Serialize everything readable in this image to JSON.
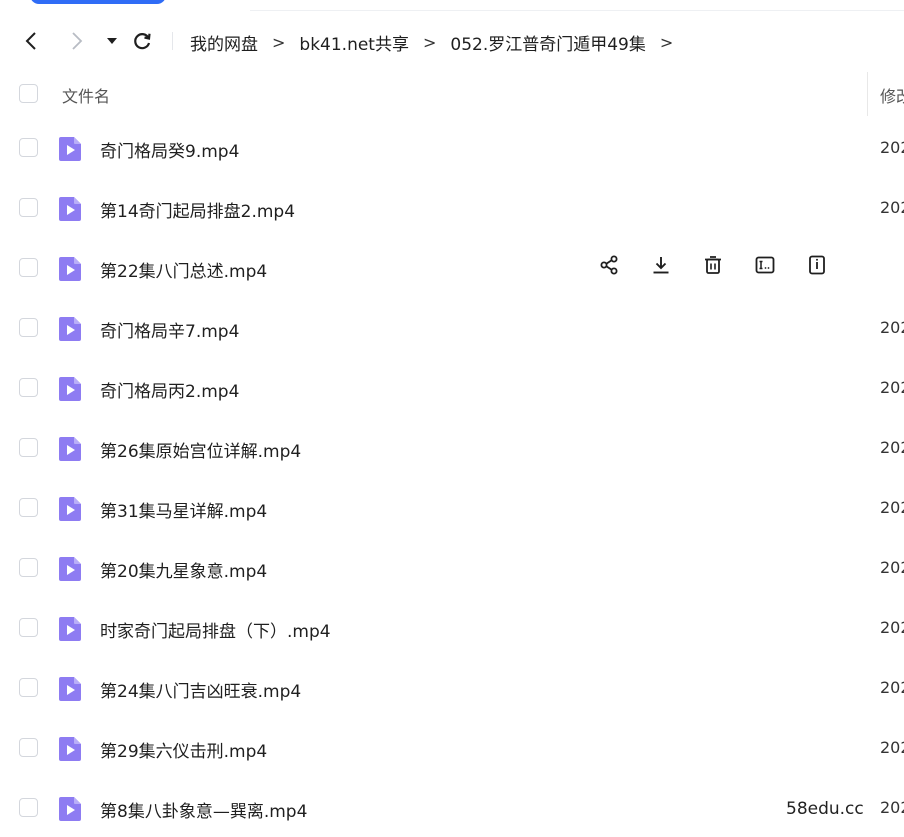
{
  "breadcrumb": [
    "我的网盘",
    "bk41.net共享",
    "052.罗江普奇门遁甲49集"
  ],
  "crumb_separator": ">",
  "header": {
    "name_col": "文件名",
    "modified_col": "修改"
  },
  "files": [
    {
      "name": "奇门格局癸9.mp4",
      "date": "202"
    },
    {
      "name": "第14奇门起局排盘2.mp4",
      "date": "202"
    },
    {
      "name": "第22集八门总述.mp4",
      "date": ""
    },
    {
      "name": "奇门格局辛7.mp4",
      "date": "202"
    },
    {
      "name": "奇门格局丙2.mp4",
      "date": "202"
    },
    {
      "name": "第26集原始宫位详解.mp4",
      "date": "202"
    },
    {
      "name": "第31集马星详解.mp4",
      "date": "202"
    },
    {
      "name": "第20集九星象意.mp4",
      "date": "202"
    },
    {
      "name": "时家奇门起局排盘（下）.mp4",
      "date": "202"
    },
    {
      "name": "第24集八门吉凶旺衰.mp4",
      "date": "202"
    },
    {
      "name": "第29集六仪击刑.mp4",
      "date": "202"
    },
    {
      "name": "第8集八卦象意—巽离.mp4",
      "date": "202"
    }
  ],
  "hover_row_index": 2,
  "row_action_icons": [
    "share-icon",
    "download-icon",
    "delete-icon",
    "rename-icon",
    "details-icon"
  ],
  "watermark": "58edu.cc",
  "colors": {
    "accent": "#2f6cf6",
    "video_icon": "#8e7cf2"
  }
}
